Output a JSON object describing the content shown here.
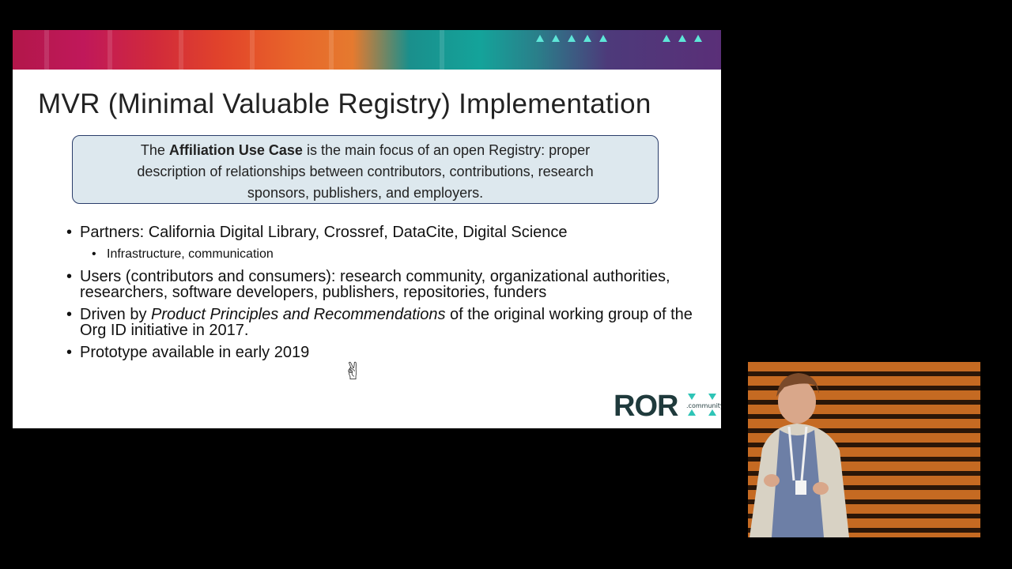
{
  "slide": {
    "title": "MVR (Minimal Valuable Registry) Implementation",
    "callout": {
      "prefix": "The ",
      "bold": "Affiliation Use Case",
      "line1_rest": " is the main focus of an open Registry: proper",
      "line2": "description of relationships between contributors, contributions, research",
      "line3": "sponsors, publishers, and employers."
    },
    "bullets": {
      "partners": "Partners: California Digital Library, Crossref, DataCite, Digital Science",
      "partners_sub": "Infrastructure, communication",
      "users": "Users (contributors and consumers): research community, organizational authorities, researchers, software developers, publishers, repositories, funders",
      "driven_prefix": "Driven by ",
      "driven_italic": "Product Principles and Recommendations",
      "driven_rest": " of the original working group of the Org ID initiative in 2017.",
      "prototype": "Prototype available in early 2019"
    },
    "hand_emoji": "✌",
    "logo": {
      "main": "ROR",
      "sub": ".community"
    }
  },
  "colors": {
    "callout_bg": "#dde8ee",
    "callout_border": "#2a3d6a",
    "logo_dark": "#1f3a3c",
    "logo_teal": "#2ec4b6"
  },
  "icons": [
    "crossed-fingers-icon",
    "ror-x-icon"
  ]
}
